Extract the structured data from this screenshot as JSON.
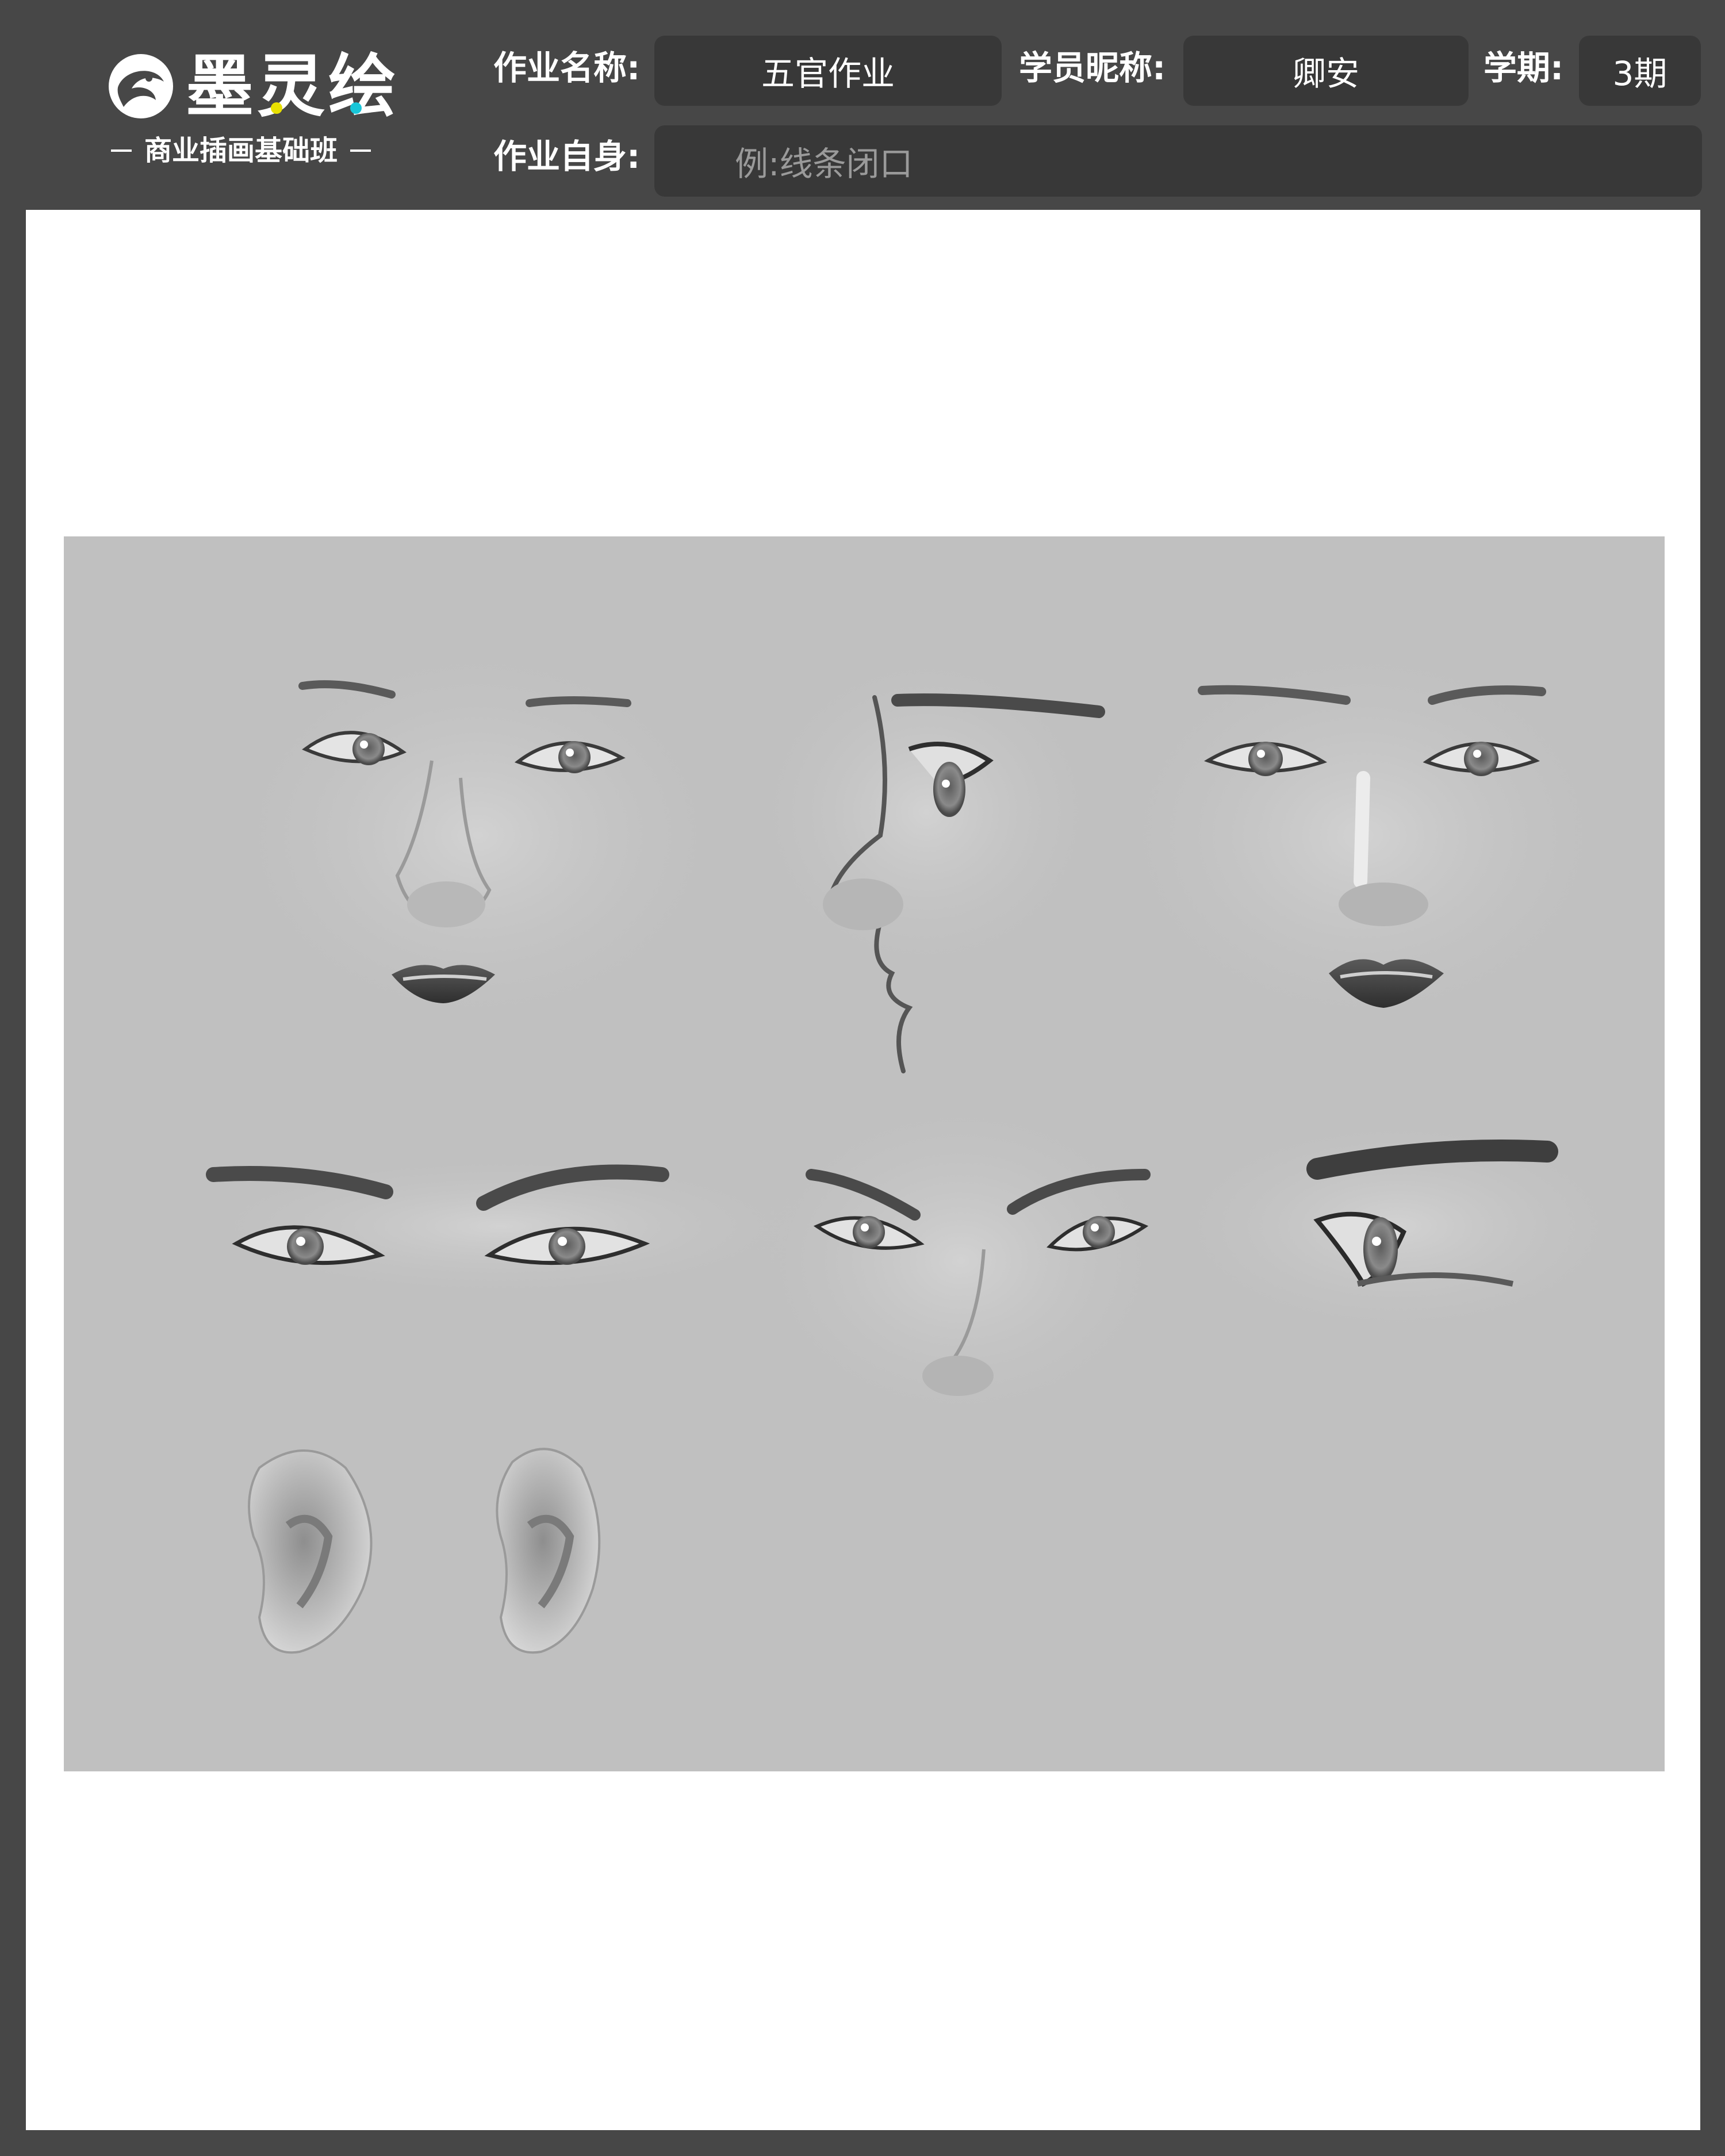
{
  "brand": {
    "title": "墨灵绘",
    "subtitle": "商业插画基础班",
    "accent_yellow": "#e8e000",
    "accent_cyan": "#18c6d8"
  },
  "form": {
    "assignment_name_label": "作业名称:",
    "assignment_name_value": "五官作业",
    "nickname_label": "学员昵称:",
    "nickname_value": "卿安",
    "term_label": "学期:",
    "term_value": "3期",
    "self_label": "作业自身:",
    "self_placeholder": "例:线条闭口"
  },
  "artwork": {
    "subject": "facial-features-study",
    "background": "#c0c0c0"
  }
}
